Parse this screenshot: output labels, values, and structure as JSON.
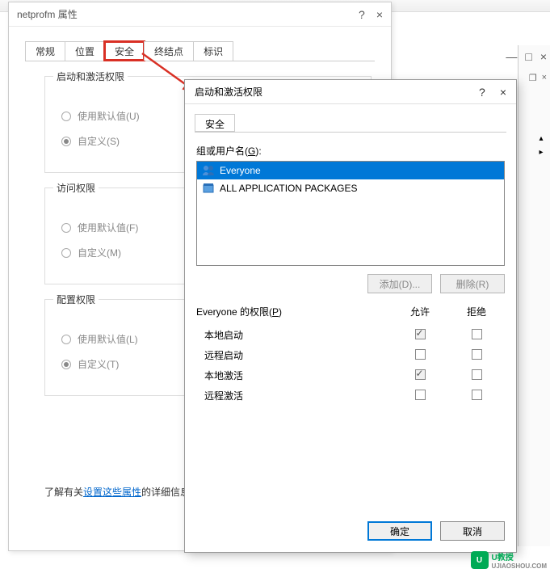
{
  "dialog1": {
    "title": "netprofm 属性",
    "help_glyph": "?",
    "close_glyph": "×",
    "tabs": [
      "常规",
      "位置",
      "安全",
      "终结点",
      "标识"
    ],
    "groups": {
      "g1": {
        "title": "启动和激活权限",
        "opt1": "使用默认值(U)",
        "opt2": "自定义(S)"
      },
      "g2": {
        "title": "访问权限",
        "opt1": "使用默认值(F)",
        "opt2": "自定义(M)"
      },
      "g3": {
        "title": "配置权限",
        "opt1": "使用默认值(L)",
        "opt2": "自定义(T)"
      }
    },
    "footer_prefix": "了解有关",
    "footer_link": "设置这些属性",
    "footer_suffix": "的详细信息。"
  },
  "dialog2": {
    "title": "启动和激活权限",
    "help_glyph": "?",
    "close_glyph": "×",
    "tab": "安全",
    "group_label_prefix": "组或用户名(",
    "group_label_u": "G",
    "group_label_suffix": "):",
    "items": [
      {
        "name": "Everyone",
        "selected": true,
        "icon": "users"
      },
      {
        "name": "ALL APPLICATION PACKAGES",
        "selected": false,
        "icon": "package"
      }
    ],
    "btn_add": "添加(D)...",
    "btn_remove": "删除(R)",
    "perm_label_prefix": "Everyone 的权限(",
    "perm_label_u": "P",
    "perm_label_suffix": ")",
    "col_allow": "允许",
    "col_deny": "拒绝",
    "perms": [
      {
        "name": "本地启动",
        "allow": true,
        "deny": false
      },
      {
        "name": "远程启动",
        "allow": false,
        "deny": false
      },
      {
        "name": "本地激活",
        "allow": true,
        "deny": false
      },
      {
        "name": "远程激活",
        "allow": false,
        "deny": false
      }
    ],
    "btn_ok": "确定",
    "btn_cancel": "取消"
  },
  "bgwin": {
    "min": "—",
    "max": "□",
    "close": "×",
    "small_max": "❐",
    "small_close": "×"
  },
  "side": {
    "up": "▴",
    "right": "▸"
  },
  "watermark": {
    "logo": "U",
    "text": "U教授",
    "sub": "UJIAOSHOU.COM"
  }
}
